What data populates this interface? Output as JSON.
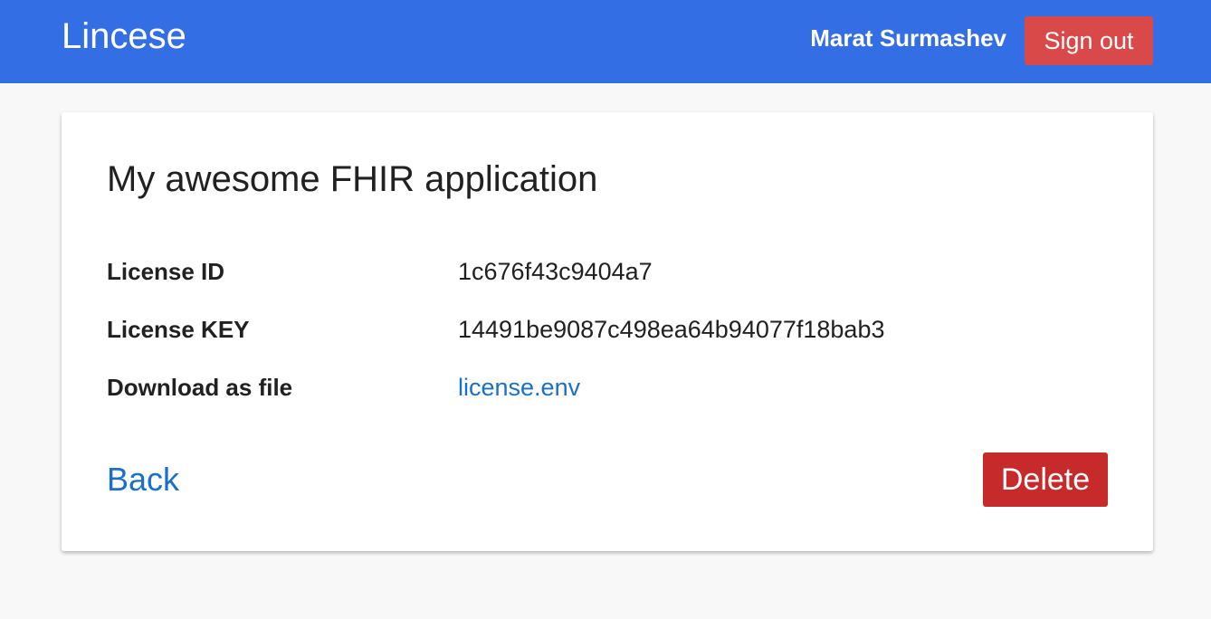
{
  "header": {
    "brand": "Lincese",
    "username": "Marat Surmashev",
    "signout_label": "Sign out"
  },
  "license": {
    "title": "My awesome FHIR application",
    "fields": [
      {
        "label": "License ID",
        "value": "1c676f43c9404a7"
      },
      {
        "label": "License KEY",
        "value": "14491be9087c498ea64b94077f18bab3"
      },
      {
        "label": "Download as file",
        "value": "license.env"
      }
    ]
  },
  "actions": {
    "back_label": "Back",
    "delete_label": "Delete"
  },
  "colors": {
    "header_bg": "#336ee4",
    "signout_bg": "#d9494a",
    "delete_bg": "#c62a2a",
    "link": "#1a6fc9",
    "page_bg": "#f8f8f8"
  }
}
